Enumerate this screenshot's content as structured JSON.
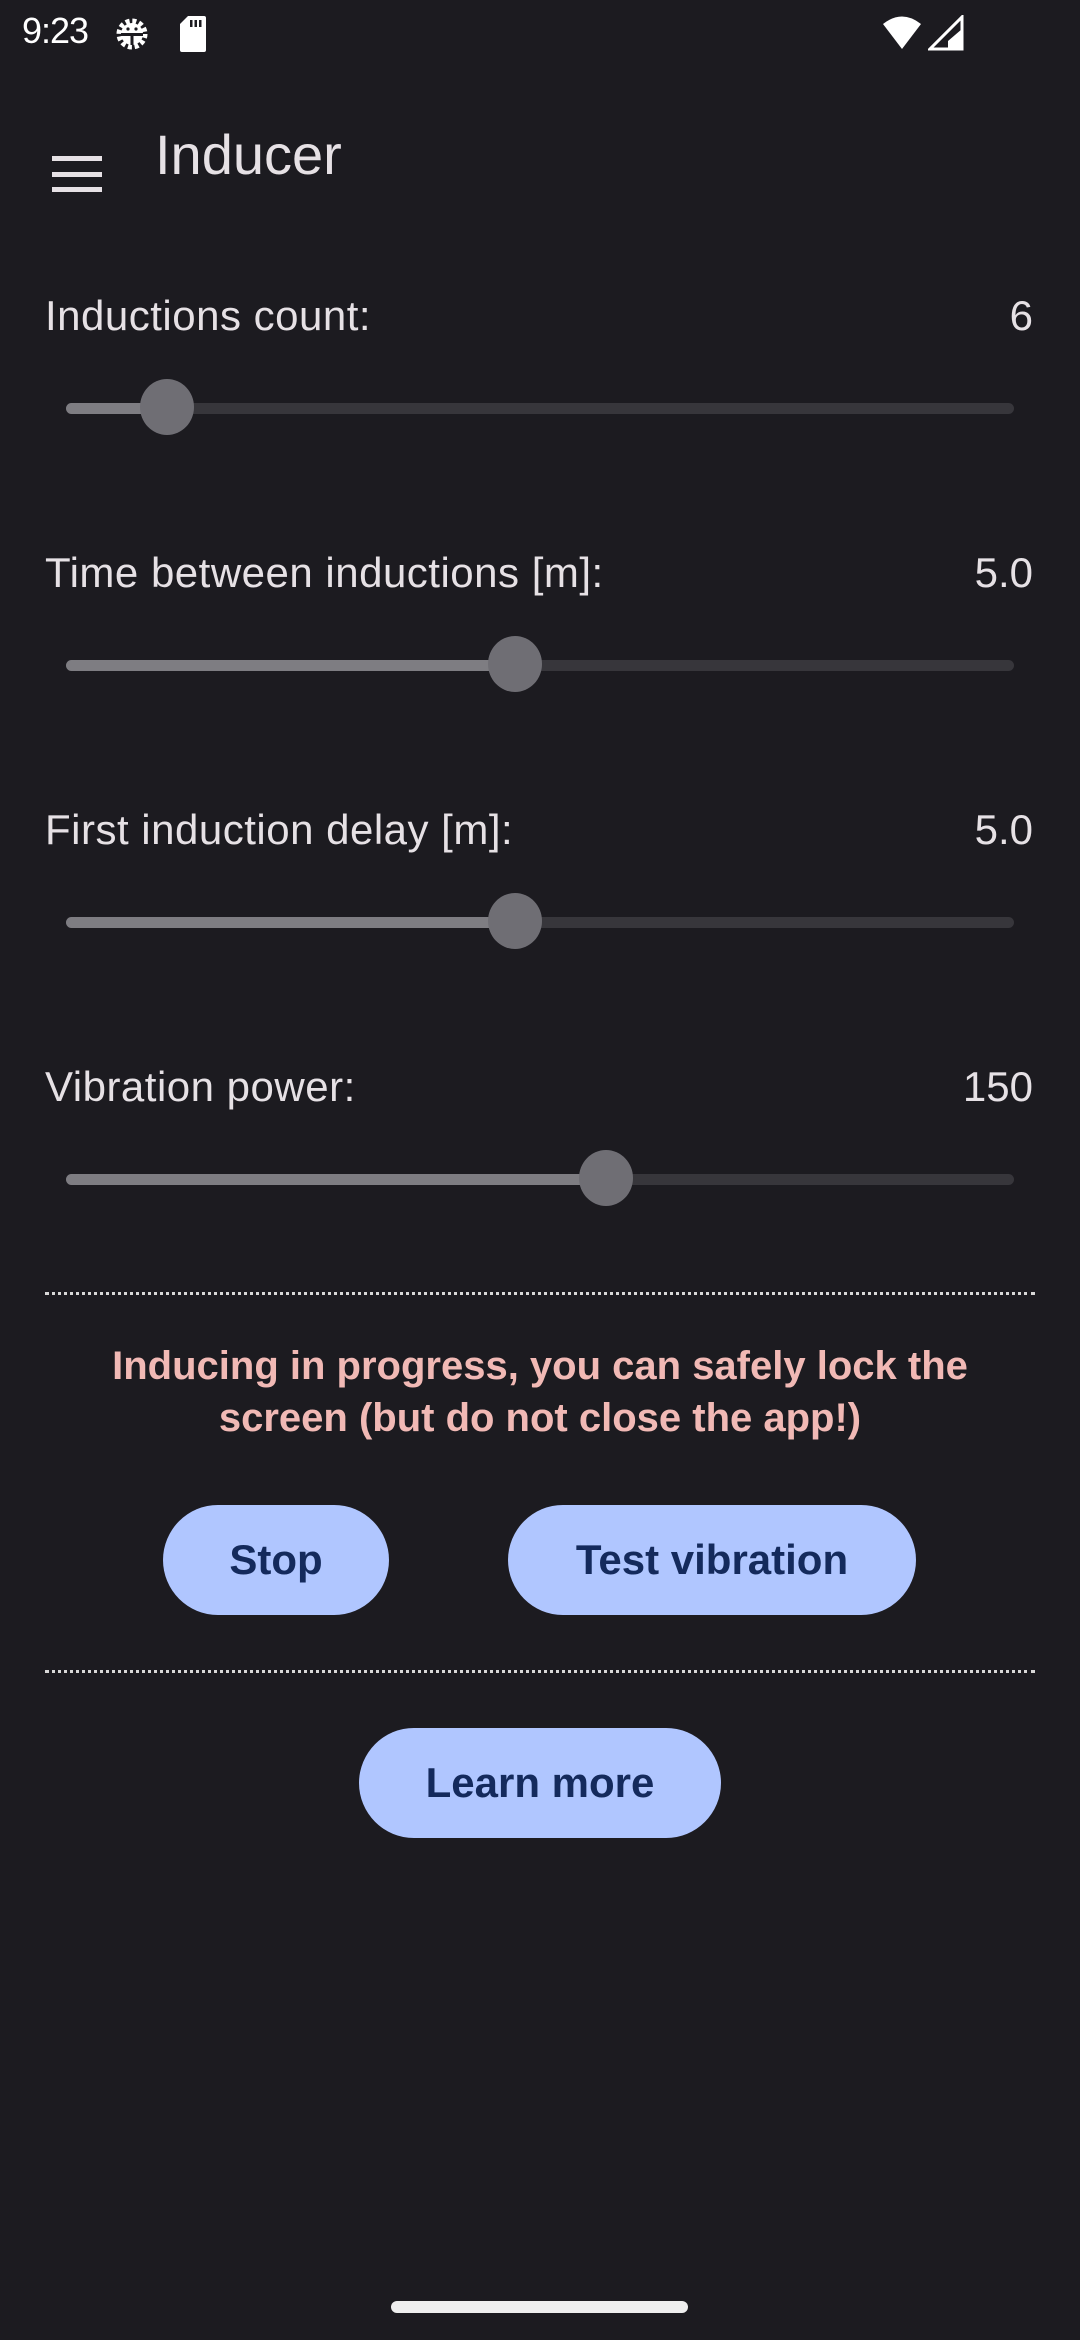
{
  "status_bar": {
    "time": "9:23",
    "left_icons": [
      "android-debug-icon",
      "sd-card-icon"
    ],
    "right_icons": [
      "wifi-icon",
      "cellular-signal-icon"
    ]
  },
  "app_bar": {
    "menu_icon": "hamburger-menu-icon",
    "title": "Inducer"
  },
  "settings": [
    {
      "label": "Inductions count:",
      "value": "6",
      "fill_fraction": 0.107
    },
    {
      "label": "Time between inductions [m]:",
      "value": "5.0",
      "fill_fraction": 0.474
    },
    {
      "label": "First induction delay [m]:",
      "value": "5.0",
      "fill_fraction": 0.474
    },
    {
      "label": "Vibration power:",
      "value": "150",
      "fill_fraction": 0.57
    }
  ],
  "status_message": "Inducing in progress, you can safely lock the screen (but do not close the app!)",
  "buttons": {
    "stop": "Stop",
    "test_vibration": "Test vibration",
    "learn_more": "Learn more"
  },
  "colors": {
    "background": "#1c1b20",
    "accent_button": "#b0c6ff",
    "button_text": "#142a5c",
    "status_text": "#f1b9b5"
  }
}
